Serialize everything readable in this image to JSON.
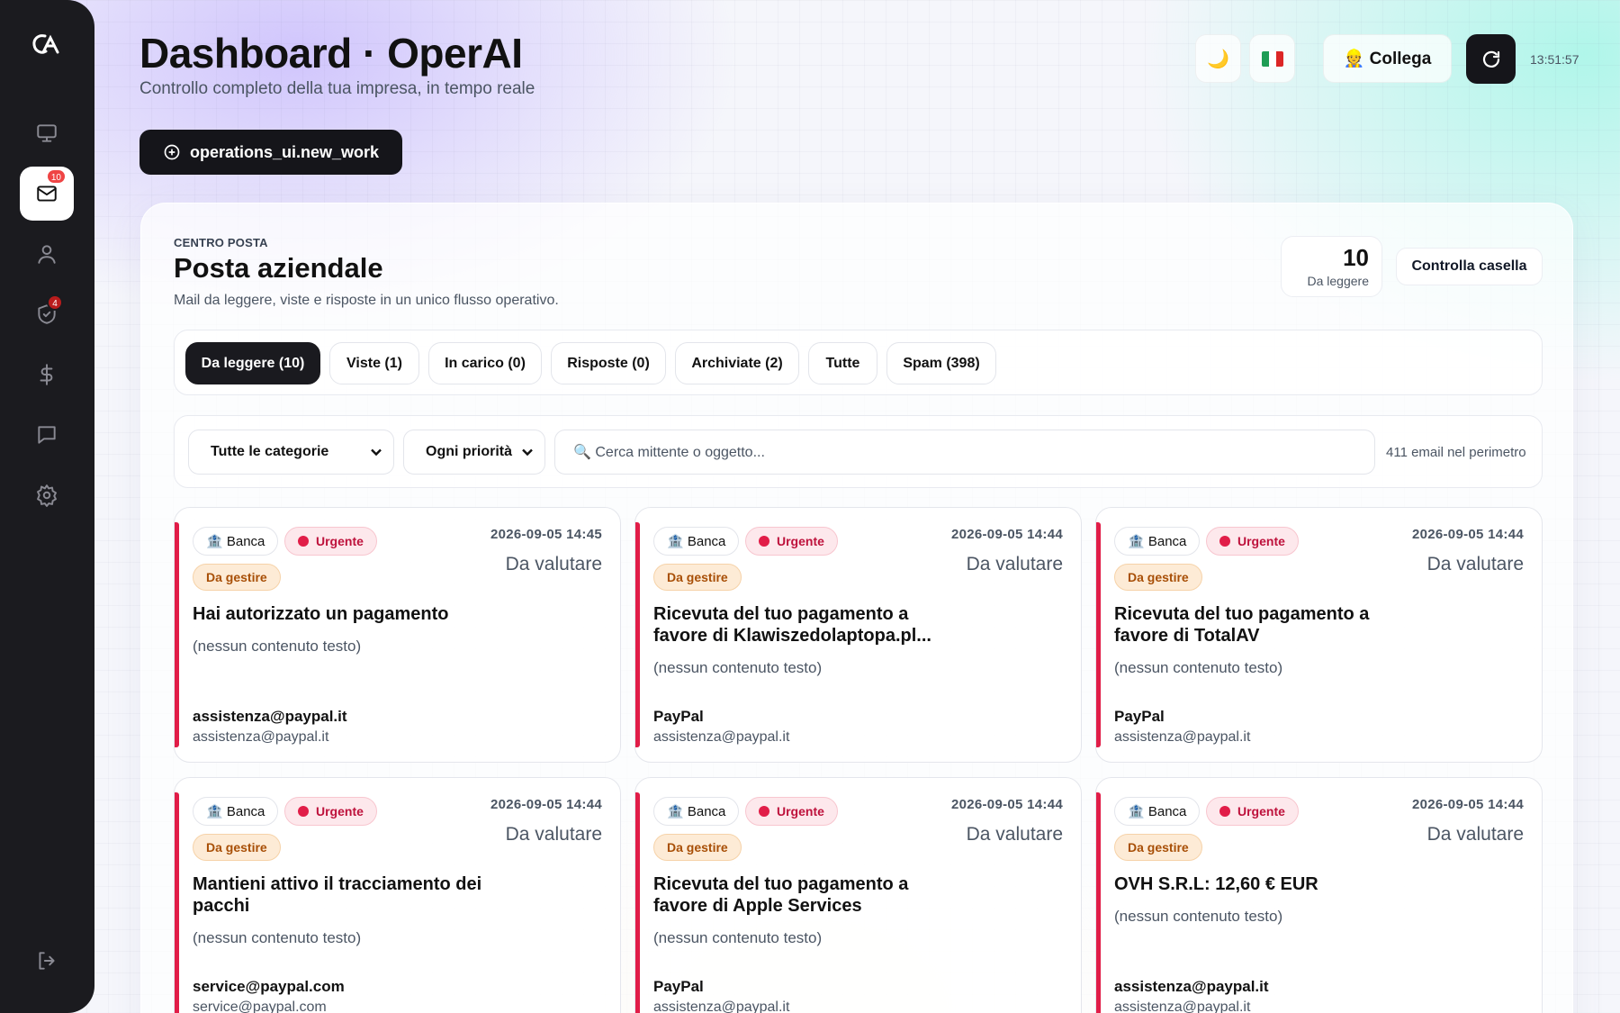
{
  "header": {
    "title": "Dashboard · OperAI",
    "subtitle": "Controllo completo della tua impresa, in tempo reale",
    "new_work_label": "operations_ui.new_work",
    "theme_icon": "🌙",
    "collega_label": "👷 Collega",
    "clock": "13:51:57"
  },
  "sidebar": {
    "mail_badge": "10",
    "shield_badge": "4"
  },
  "mailbox": {
    "eyebrow": "CENTRO POSTA",
    "title": "Posta aziendale",
    "subtitle": "Mail da leggere, viste e risposte in un unico flusso operativo.",
    "unread_count": "10",
    "unread_label": "Da leggere",
    "check_label": "Controlla casella",
    "tabs": [
      {
        "label": "Da leggere (10)"
      },
      {
        "label": "Viste (1)"
      },
      {
        "label": "In carico (0)"
      },
      {
        "label": "Risposte (0)"
      },
      {
        "label": "Archiviate (2)"
      },
      {
        "label": "Tutte"
      },
      {
        "label": "Spam (398)"
      }
    ],
    "filters": {
      "category": "Tutte le categorie",
      "priority": "Ogni priorità",
      "search_placeholder": "🔍 Cerca mittente o oggetto...",
      "total": "411 email nel perimetro"
    },
    "emails": [
      {
        "category": "🏦 Banca",
        "priority": "Urgente",
        "state": "Da gestire",
        "date": "2026-09-05 14:45",
        "evaluation": "Da valutare",
        "subject": "Hai autorizzato un pagamento",
        "body": "(nessun contenuto testo)",
        "sender": "assistenza@paypal.it",
        "email": "assistenza@paypal.it"
      },
      {
        "category": "🏦 Banca",
        "priority": "Urgente",
        "state": "Da gestire",
        "date": "2026-09-05 14:44",
        "evaluation": "Da valutare",
        "subject": "Ricevuta del tuo pagamento a favore di Klawiszedolaptopa.pl...",
        "body": "(nessun contenuto testo)",
        "sender": "PayPal",
        "email": "assistenza@paypal.it"
      },
      {
        "category": "🏦 Banca",
        "priority": "Urgente",
        "state": "Da gestire",
        "date": "2026-09-05 14:44",
        "evaluation": "Da valutare",
        "subject": "Ricevuta del tuo pagamento a favore di TotalAV",
        "body": "(nessun contenuto testo)",
        "sender": "PayPal",
        "email": "assistenza@paypal.it"
      },
      {
        "category": "🏦 Banca",
        "priority": "Urgente",
        "state": "Da gestire",
        "date": "2026-09-05 14:44",
        "evaluation": "Da valutare",
        "subject": "Mantieni attivo il tracciamento dei pacchi",
        "body": "(nessun contenuto testo)",
        "sender": "service@paypal.com",
        "email": "service@paypal.com"
      },
      {
        "category": "🏦 Banca",
        "priority": "Urgente",
        "state": "Da gestire",
        "date": "2026-09-05 14:44",
        "evaluation": "Da valutare",
        "subject": "Ricevuta del tuo pagamento a favore di Apple Services",
        "body": "(nessun contenuto testo)",
        "sender": "PayPal",
        "email": "assistenza@paypal.it"
      },
      {
        "category": "🏦 Banca",
        "priority": "Urgente",
        "state": "Da gestire",
        "date": "2026-09-05 14:44",
        "evaluation": "Da valutare",
        "subject": "OVH S.R.L: 12,60 € EUR",
        "body": "(nessun contenuto testo)",
        "sender": "assistenza@paypal.it",
        "email": "assistenza@paypal.it"
      }
    ]
  }
}
